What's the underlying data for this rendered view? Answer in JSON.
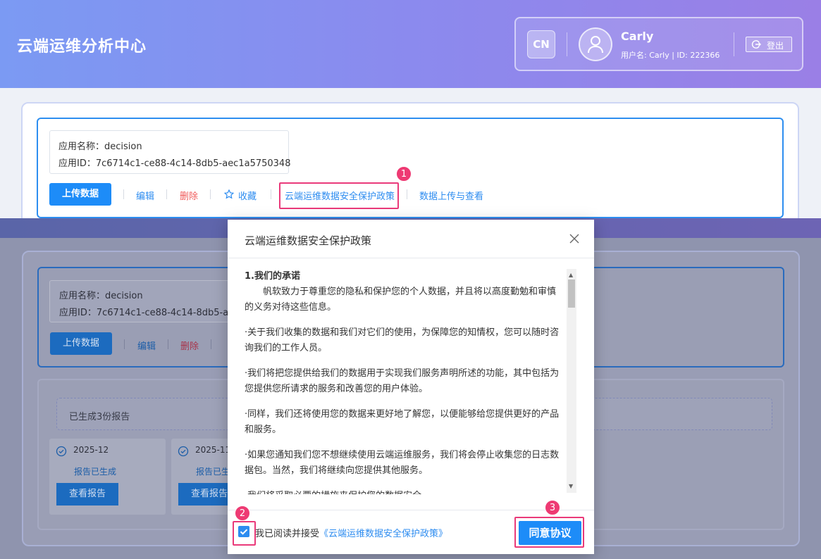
{
  "header": {
    "title": "云端运维分析中心",
    "lang": "CN",
    "user_name": "Carly",
    "user_info": "用户名: Carly | ID: 222366",
    "logout_label": "登出"
  },
  "app": {
    "name_line": "应用名称：decision",
    "id_line": "应用ID：7c6714c1-ce88-4c14-8db5-aec1a5750348",
    "actions": {
      "upload": "上传数据",
      "edit": "编辑",
      "delete": "删除",
      "favorite": "收藏",
      "policy": "云端运维数据安全保护政策",
      "view_uploads": "数据上传与查看"
    }
  },
  "background": {
    "id_line_truncated": "应用ID：7c6714c1-ce88-4c14-8db5-ae",
    "report_notice": "已生成3份报告",
    "tiles": [
      {
        "date": "2025-12",
        "status": "报告已生成",
        "button": "查看报告"
      },
      {
        "date": "2025-11",
        "status": "报告已生",
        "button": "查看报告"
      }
    ]
  },
  "modal": {
    "title": "云端运维数据安全保护政策",
    "section_heading": "1.我们的承诺",
    "paragraphs": [
      "帆软致力于尊重您的隐私和保护您的个人数据，并且将以高度勤勉和审慎的义务对待这些信息。",
      "·关于我们收集的数据和我们对它们的使用，为保障您的知情权，您可以随时咨询我们的工作人员。",
      "·我们将把您提供给我们的数据用于实现我们服务声明所述的功能，其中包括为您提供您所请求的服务和改善您的用户体验。",
      "·同样，我们还将使用您的数据来更好地了解您，以便能够给您提供更好的产品和服务。",
      "·如果您通知我们您不想继续使用云端运维服务，我们将会停止收集您的日志数据包。当然，我们将继续向您提供其他服务。",
      "·我们将采取必要的措施来保护您的数据安全。"
    ],
    "agree_prefix": "我已阅读并接受",
    "agree_link": "《云端运维数据安全保护政策》",
    "agree_button": "同意协议",
    "checkbox_checked": true
  },
  "annotations": {
    "badge1": "1",
    "badge2": "2",
    "badge3": "3",
    "color": "#ea3a7a"
  }
}
